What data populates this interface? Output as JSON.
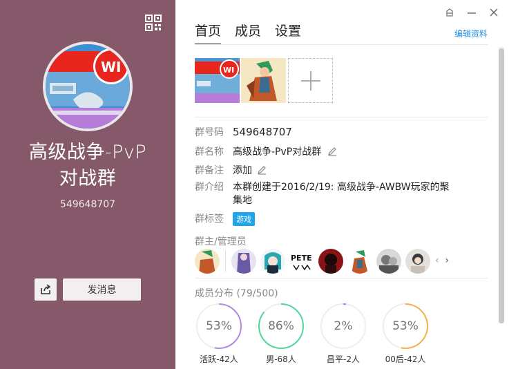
{
  "left": {
    "group_name_line1": "高级战争-PvP",
    "group_name_line2": "对战群",
    "group_number": "549648707",
    "send_message": "发消息"
  },
  "tabs": [
    "首页",
    "成员",
    "设置"
  ],
  "edit_profile": "编辑资料",
  "info": {
    "id_label": "群号码",
    "id_value": "549648707",
    "name_label": "群名称",
    "name_value": "高级战争-PvP对战群",
    "remark_label": "群备注",
    "remark_value": "添加",
    "intro_label": "群介绍",
    "intro_line1": "本群创建于2016/2/19:  高级战争-AWBW玩家的聚",
    "intro_line2": "集地",
    "tag_label": "群标签",
    "tag_value": "游戏"
  },
  "admins_label": "群主/管理员",
  "member_dist": {
    "label": "成员分布",
    "count": "(79/500)",
    "stats": [
      {
        "percent": "53%",
        "caption": "活跃-42人",
        "value": 0.53,
        "color": "#b28be0"
      },
      {
        "percent": "86%",
        "caption": "男-68人",
        "value": 0.86,
        "color": "#54d69a"
      },
      {
        "percent": "2%",
        "caption": "昌平-2人",
        "value": 0.02,
        "color": "#9a8ad8"
      },
      {
        "percent": "53%",
        "caption": "00后-42人",
        "value": 0.53,
        "color": "#f2b24a"
      }
    ]
  },
  "colors": {
    "left_bg": "#85596a",
    "accent_link": "#1f8de6",
    "tag_bg": "#1fa6ea"
  }
}
